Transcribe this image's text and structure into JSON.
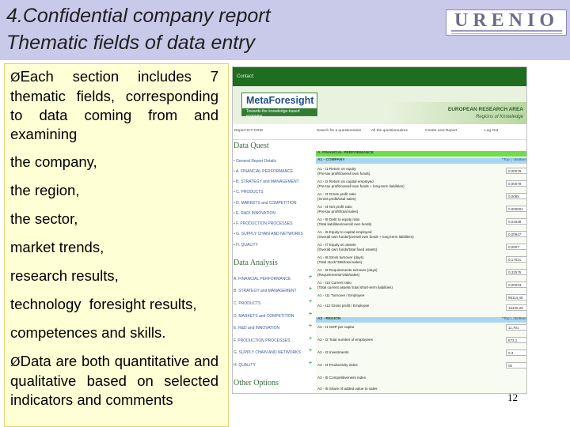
{
  "slide": {
    "title_line1": "4.Confidential company report",
    "title_line2": "Thematic fields of data entry",
    "logo_text": "URENIO",
    "page_number": "12"
  },
  "text_panel": {
    "bullet1": "Each section includes 7 thematic fields, corresponding to data coming from and examining",
    "items": [
      "the company,",
      "the region,",
      "the sector,",
      "market trends,",
      "research results,",
      "technology  foresight results,",
      "competences and skills."
    ],
    "bullet2": "Data are both quantitative and qualitative based on selected indicators and comments",
    "bullet_glyph": "Ø",
    "panel_color": "#ffffd6"
  },
  "screenshot": {
    "contact": "Contact:",
    "brand": "MetaForesight",
    "brand_tagline": "Towards the knowledge-based economy",
    "era_line1": "EUROPEAN RESEARCH AREA",
    "era_line2": "Regions of Knowledge",
    "nav": {
      "report": "Report:ICT-CRM",
      "search": "Search for a questionnaire",
      "all": "All the questionnaires",
      "create": "Create new Report",
      "logout": "Log Out"
    },
    "data_quest": {
      "heading": "Data Quest",
      "items": [
        "General Report Details",
        "A. FINANCIAL PERFORMANCE",
        "B. STRATEGY and MANAGEMENT",
        "C. PRODUCTS",
        "D. MARKETS and COMPETITION",
        "E. R&D/ INNOVATION",
        "F. PRODUCTION PROCESSES",
        "G. SUPPLY CHAIN AND NETWORKS",
        "H. QUALITY"
      ]
    },
    "data_analysis": {
      "heading": "Data Analysis",
      "items": [
        "A. FINANCIAL PERFORMANCE",
        "B. STRATEGY and MANAGEMENT",
        "C. PRODUCTS",
        "D. MARKETS and COMPETITION",
        "E. R&D and INNOVATION",
        "F. PRODUCTION PROCESSES",
        "G. SUPPLY CHAIN AND NETWORKS",
        "H. QUALITY"
      ]
    },
    "other_options_heading": "Other Options",
    "financial_band": "A. FINANCIAL PERFORMANCE",
    "company_band": "A1 - COMPANY",
    "company_toplink": "*Top | ↓Bottom",
    "region_band": "A2 - REGION",
    "region_toplink": "*Top | ↓Bottom",
    "company_rows": [
      {
        "label": "A1 - I1 Return on equity",
        "sub": "(Pre-tax profit/overall own funds)",
        "value": "0,00079"
      },
      {
        "label": "A1 - I2 Return on capital employed",
        "sub": "(Pre-tax profit/overall own funds + long-term liabilities)",
        "value": "0,00079"
      },
      {
        "label": "A1 - I3 Gross profit ratio",
        "sub": "(Gross profit/total sales)",
        "value": "0,0085"
      },
      {
        "label": "A1 - I4 Net profit ratio",
        "sub": "(Pre-tax profit/total sales)",
        "value": "0,000001"
      },
      {
        "label": "A1 - I5 Debt to equity ratio",
        "sub": "(Total liabilities/overall own funds)",
        "value": "0,01539"
      },
      {
        "label": "A1 - I6 Equity to capital employed",
        "sub": "(Overall own funds/(overall own funds + long-term liabilities)",
        "value": "0,00947"
      },
      {
        "label": "A1 - I7 Equity on assets",
        "sub": "(Overall own funds/total fixed assets)",
        "value": "0,0007"
      },
      {
        "label": "A1 - I8 Stock turnover (days)",
        "sub": "(Total stock*365/total sales)",
        "value": "0,17021"
      },
      {
        "label": "A1 - I9 Requirements turnover (days)",
        "sub": "(Requirements*365/sales)",
        "value": "0,32575"
      },
      {
        "label": "A1 - I10 Current ratio",
        "sub": "(Total current assets/ total short-term liabilities)",
        "value": "0,00043"
      },
      {
        "label": "A1 - I11 Turnover / Employee",
        "sub": "",
        "value": "95114,46"
      },
      {
        "label": "A1 - I12 Gross profit / Employee",
        "sub": "",
        "value": "16446,28"
      }
    ],
    "region_rows": [
      {
        "label": "A2 - I1 GDP per capita",
        "value": "11,791"
      },
      {
        "label": "A2 - I2 Total number of employees",
        "value": "673,1"
      },
      {
        "label": "A2 - I3 Investments",
        "value": "0,3"
      },
      {
        "label": "A2 - I4 Productivity index",
        "value": "0b"
      },
      {
        "label": "A2 - I5 Competitiveness index",
        "value": ""
      },
      {
        "label": "A2 - I6 Share of added value to sales",
        "value": ""
      }
    ],
    "colors": {
      "contact_bar": "#1f6d1f",
      "financial_band": "#6fdc4a",
      "company_band": "#a9d6f2",
      "region_band": "#a9d6f2"
    }
  }
}
